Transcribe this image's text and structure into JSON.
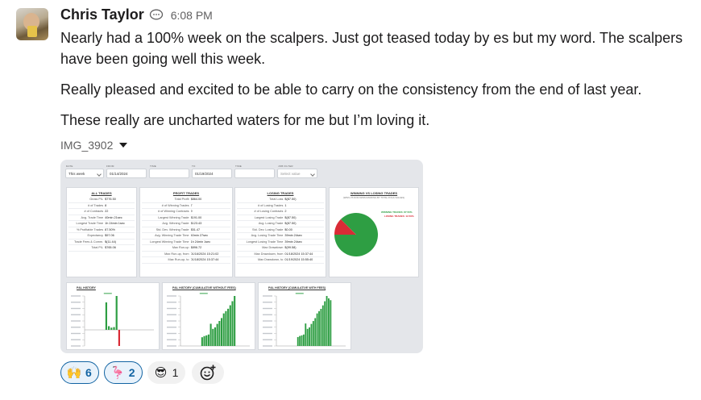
{
  "message": {
    "author": "Chris Taylor",
    "status_icon": "speech-bubble-icon",
    "time": "6:08 PM",
    "paragraphs": [
      "Nearly had a 100% week on the scalpers. Just got teased today by es but my word. The scalpers have been going well this week.",
      "Really pleased and excited to be able to carry on the consistency from the end of last year.",
      "These really are uncharted waters for me but I’m loving it."
    ]
  },
  "attachment": {
    "filename": "IMG_3902",
    "filters": {
      "labels": [
        "DATE",
        "FROM",
        "TIME",
        "TO",
        "TIME",
        "JOB FILTER"
      ],
      "range": "This week",
      "from": "01/14/2024",
      "to": "01/19/2024",
      "job": "Select value"
    },
    "all_trades": {
      "title": "ALL TRADES",
      "rows": [
        [
          "Gross P/L",
          "$776.50"
        ],
        [
          "# of Trades",
          "8"
        ],
        [
          "# of Contracts",
          "22"
        ],
        [
          "Avg. Trade Time",
          "40min 21sec"
        ],
        [
          "Longest Trade Time",
          "1h 24min 1sec"
        ],
        [
          "% Profitable Trades",
          "87.50%"
        ],
        [
          "Expectancy",
          "$97.06"
        ],
        [
          "Trade Fees & Comm.",
          "$(11.44)"
        ],
        [
          "Total P/L",
          "$765.06"
        ]
      ]
    },
    "profit_trades": {
      "title": "PROFIT TRADES",
      "rows": [
        [
          "Total Profit",
          "$864.00"
        ],
        [
          "# of Winning Trades",
          "7"
        ],
        [
          "# of Winning Contracts",
          "9"
        ],
        [
          "Largest Winning Trade",
          "$191.00"
        ],
        [
          "Avg. Winning Trade",
          "$123.43"
        ],
        [
          "Std. Dev. Winning Trade",
          "$51.47"
        ],
        [
          "Avg. Winning Trade Time",
          "40min 27sec"
        ],
        [
          "Longest Winning Trade Time",
          "1h 24min 1sec"
        ],
        [
          "Max Run-up",
          "$896.72"
        ],
        [
          "Max Run-up, from",
          "01/16/2024 15:21:02"
        ],
        [
          "Max Run-up, to",
          "01/18/2024 15:37:44"
        ]
      ]
    },
    "losing_trades": {
      "title": "LOSING TRADES",
      "rows": [
        [
          "Total Loss",
          "$(87.50)"
        ],
        [
          "# of Losing Trades",
          "1"
        ],
        [
          "# of Losing Contracts",
          "2"
        ],
        [
          "Largest Losing Trade",
          "$(87.50)"
        ],
        [
          "Avg. Losing Trade",
          "$(87.50)"
        ],
        [
          "Std. Dev. Losing Trade",
          "$0.00"
        ],
        [
          "Avg. Losing Trade Time",
          "39min 24sec"
        ],
        [
          "Longest Losing Trade Time",
          "39min 24sec"
        ],
        [
          "Max Drawdown",
          "$(99.58)"
        ],
        [
          "Max Drawdown, from",
          "01/18/2024 15:37:44"
        ],
        [
          "Max Drawdown, to",
          "01/19/2024 15:55:40"
        ]
      ]
    },
    "win_loss": {
      "title": "WINNING VS LOSING TRADES",
      "caption": "(WINS VS NON-WINS RANKING BY TOTAL IN $ & VALUES)",
      "legend": [
        "WINNING TRADES: 87.50%",
        "LOSING TRADES: 12.50%"
      ],
      "colors": {
        "win": "#2e9e43",
        "loss": "#d92b36"
      }
    },
    "chart_data": [
      {
        "type": "pie",
        "title": "WINNING VS LOSING TRADES",
        "labels": [
          "Winning Trades",
          "Losing Trades"
        ],
        "values": [
          87.5,
          12.5
        ]
      },
      {
        "type": "bar",
        "title": "P&L HISTORY",
        "values": [
          150,
          20,
          12,
          15,
          185,
          -88
        ],
        "colors": {
          "positive": "#2e9e43",
          "negative": "#d92b36"
        }
      },
      {
        "type": "bar",
        "title": "P&L HISTORY (CUMULATIVE WITHOUT FEES)",
        "values": [
          150,
          170,
          182,
          197,
          382,
          294,
          320,
          380,
          430,
          480,
          560,
          600,
          640,
          700,
          770,
          860
        ]
      },
      {
        "type": "bar",
        "title": "P&L HISTORY (CUMULATIVE WITH FEES)",
        "values": [
          148,
          166,
          176,
          190,
          373,
          284,
          308,
          366,
          414,
          462,
          540,
          578,
          616,
          674,
          742,
          830,
          790,
          760
        ]
      }
    ]
  },
  "reactions": [
    {
      "icon": "raised-hands-icon",
      "glyph": "🙌",
      "count": "6",
      "active": true
    },
    {
      "icon": "flamingo-icon",
      "glyph": "🦩",
      "count": "2",
      "active": true
    },
    {
      "icon": "sunglasses-face-icon",
      "glyph": "😎",
      "count": "1",
      "active": false
    }
  ]
}
